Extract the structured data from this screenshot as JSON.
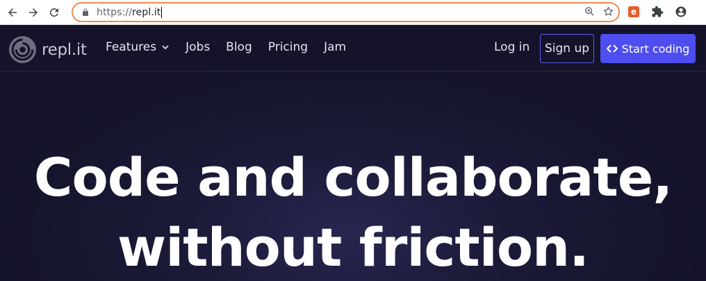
{
  "browser": {
    "url_scheme": "https://",
    "url_host": "repl.it"
  },
  "site": {
    "logo_text": "repl.it",
    "menu": [
      {
        "label": "Features"
      },
      {
        "label": "Jobs"
      },
      {
        "label": "Blog"
      },
      {
        "label": "Pricing"
      },
      {
        "label": "Jam"
      }
    ],
    "login_label": "Log in",
    "signup_label": "Sign up",
    "start_label": "Start coding"
  },
  "hero": {
    "line1": "Code and collaborate,",
    "line2": "without friction."
  },
  "colors": {
    "accent": "#4e4ef0",
    "background": "#14132a",
    "omnibox_focus": "#f08a4b"
  },
  "icons": [
    "back-arrow-icon",
    "forward-arrow-icon",
    "reload-icon",
    "lock-icon",
    "zoom-icon",
    "star-icon",
    "puzzle-icon",
    "account-icon",
    "chevron-down-icon",
    "code-brackets-icon",
    "replit-logo-icon"
  ]
}
